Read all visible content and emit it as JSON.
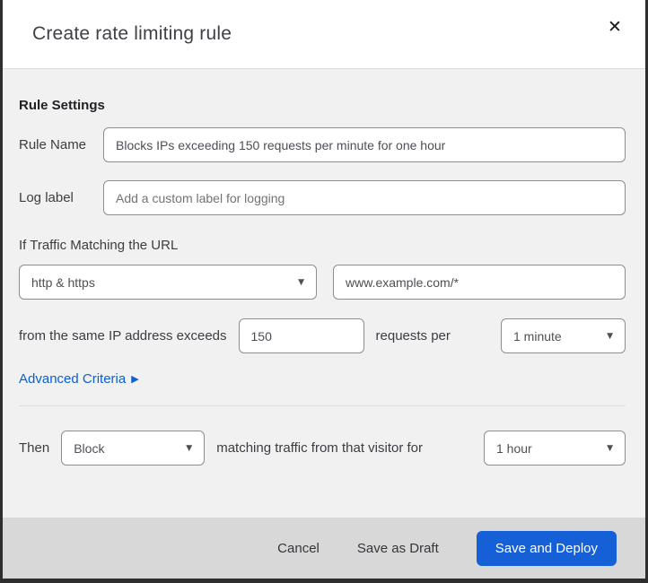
{
  "colors": {
    "primary_button": "#1560d6",
    "link": "#0b5fd0",
    "body_bg": "#f1f1f1",
    "footer_bg": "#d8d8d8",
    "top_strip": "#04202c",
    "frame_border": "#2e2e2e"
  },
  "header": {
    "title": "Create rate limiting rule",
    "close_icon": "✕"
  },
  "form": {
    "section_heading": "Rule Settings",
    "rule_name_label": "Rule Name",
    "rule_name_value": "Blocks IPs exceeding 150 requests per minute for one hour",
    "log_label_label": "Log label",
    "log_label_placeholder": "Add a custom label for logging",
    "match_intro": "If Traffic Matching the URL",
    "scheme_value": "http & https",
    "url_value": "www.example.com/*",
    "threshold_prefix": "from the same IP address exceeds",
    "threshold_value": "150",
    "threshold_suffix": "requests per",
    "period_value": "1 minute",
    "advanced_link_label": "Advanced Criteria",
    "advanced_arrow_icon": "▶",
    "then_label": "Then",
    "action_value": "Block",
    "then_middle": "matching traffic from that visitor for",
    "duration_value": "1 hour",
    "caret_icon": "▼"
  },
  "footer": {
    "cancel_label": "Cancel",
    "save_draft_label": "Save as Draft",
    "save_deploy_label": "Save and Deploy"
  }
}
